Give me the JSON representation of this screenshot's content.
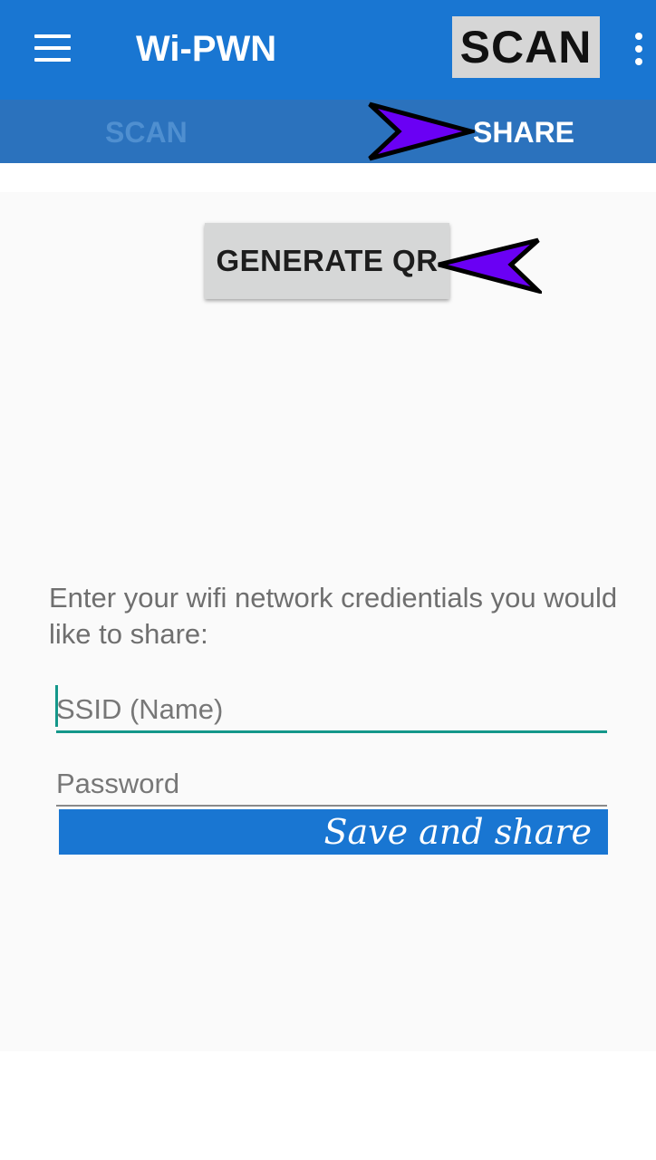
{
  "app_bar": {
    "title": "Wi-PWN",
    "scan_action_label": "SCAN"
  },
  "tabs": [
    {
      "label": "SCAN",
      "active": false
    },
    {
      "label": "SHARE",
      "active": true
    }
  ],
  "share": {
    "generate_qr_label": "GENERATE QR",
    "instructions": "Enter your wifi network credientials you would like to share:",
    "ssid_placeholder": "SSID (Name)",
    "password_placeholder": "Password",
    "save_label": "Save and share"
  },
  "colors": {
    "primary": "#1976d2",
    "tab_bar": "#2b72bd",
    "accent": "#14978a",
    "annotation_arrow": "#6a00f4"
  },
  "icons": [
    "menu-icon",
    "overflow-menu-icon",
    "arrow-annotation-icon"
  ]
}
